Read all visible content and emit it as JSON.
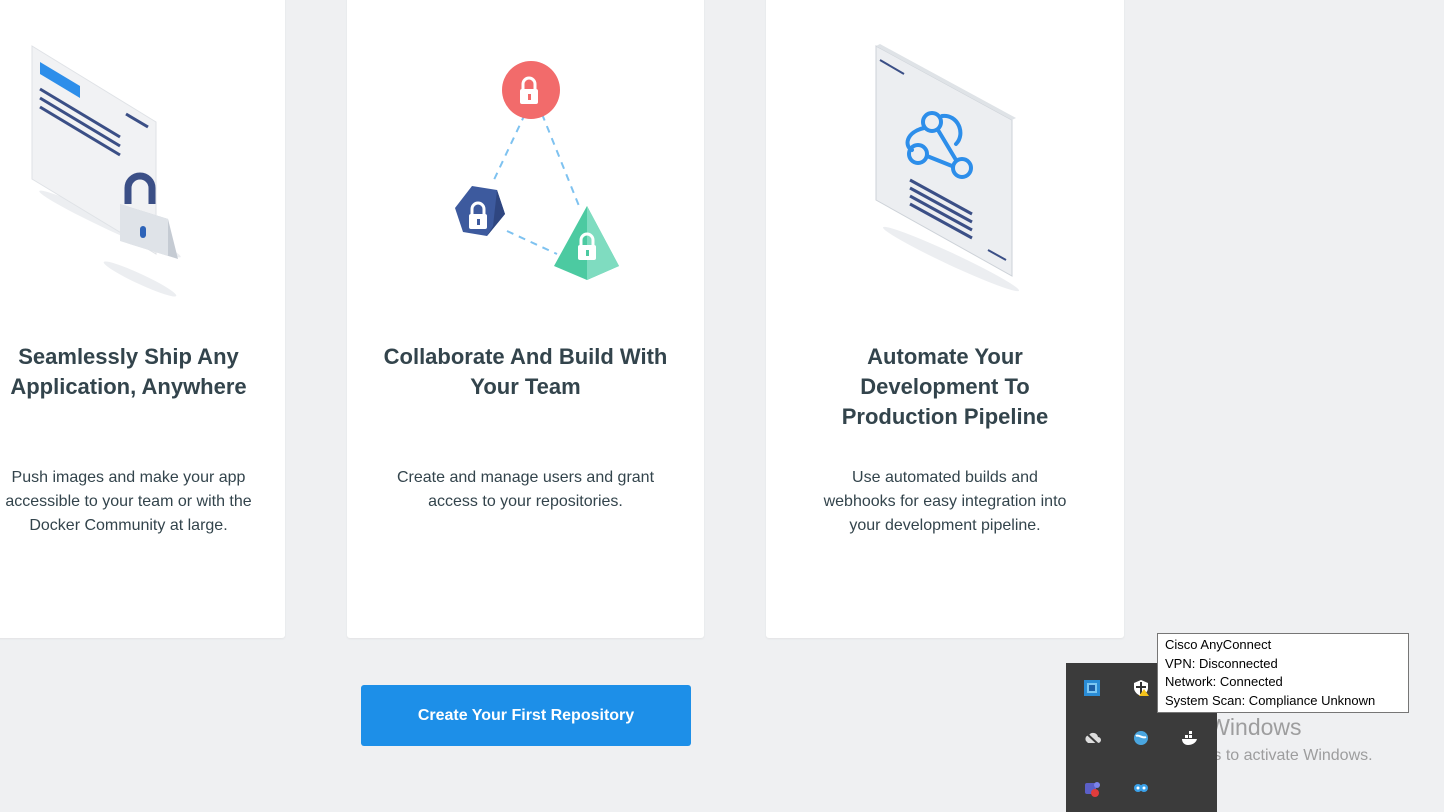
{
  "cards": [
    {
      "title": "Seamlessly Ship Any\nApplication, Anywhere",
      "description": "Push images and make your app\naccessible to your team or with the\nDocker Community at large.",
      "illustration": "document-with-padlock-illustration"
    },
    {
      "title": "Collaborate And Build With\nYour Team",
      "description": "Create and manage users and grant\naccess to your repositories.",
      "illustration": "team-network-padlocks-illustration"
    },
    {
      "title": "Automate Your\nDevelopment To\nProduction Pipeline",
      "description": "Use automated builds and\nwebhooks for easy integration into\nyour development pipeline.",
      "illustration": "webhook-document-illustration"
    }
  ],
  "cta": {
    "label": "Create Your First Repository"
  },
  "tray": {
    "tooltip": {
      "lines": [
        "Cisco AnyConnect",
        "VPN: Disconnected",
        "Network: Connected",
        "System Scan: Compliance Unknown"
      ]
    },
    "icons": [
      "app-icon",
      "security-shield-warning-icon",
      "cisco-anyconnect-icon",
      "cloud-offline-icon",
      "globe-icon",
      "docker-whale-icon",
      "teams-icon",
      "owl-app-icon"
    ]
  },
  "watermark": {
    "title": "Activate Windows",
    "subtitle": "Go to Settings to activate Windows."
  },
  "colors": {
    "primary": "#1d8fe8",
    "background": "#eff0f2",
    "text": "#33444c",
    "lock_red": "#f26b6b",
    "lock_navy": "#3d5a9e",
    "lock_green": "#4ccaa1"
  }
}
